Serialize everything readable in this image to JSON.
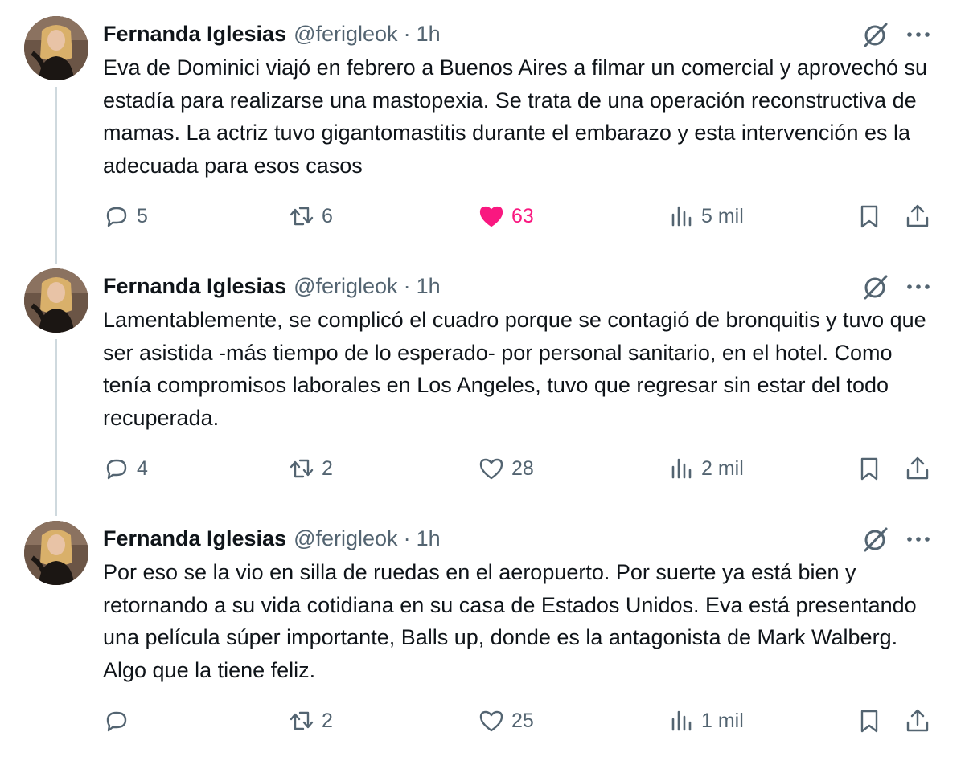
{
  "colors": {
    "text": "#0f1419",
    "secondary": "#536471",
    "like_active": "#f91880",
    "thread_line": "#cfd9de"
  },
  "tweets": [
    {
      "author_name": "Fernanda Iglesias",
      "handle": "@ferigleok",
      "separator": "·",
      "time": "1h",
      "text": "Eva de Dominici viajó en febrero a Buenos Aires a filmar un comercial y aprovechó su estadía para realizarse una mastopexia. Se trata de una operación reconstructiva de mamas. La actriz tuvo gigantomastitis durante el embarazo y esta intervención es la adecuada para esos casos",
      "replies": "5",
      "reposts": "6",
      "likes": "63",
      "liked": true,
      "views": "5 mil"
    },
    {
      "author_name": "Fernanda Iglesias",
      "handle": "@ferigleok",
      "separator": "·",
      "time": "1h",
      "text": "Lamentablemente, se complicó el cuadro porque se contagió de bronquitis y tuvo que ser asistida -más tiempo de lo esperado- por personal sanitario, en el hotel. Como tenía compromisos laborales en Los Angeles, tuvo que regresar sin estar del todo recuperada.",
      "replies": "4",
      "reposts": "2",
      "likes": "28",
      "liked": false,
      "views": "2 mil"
    },
    {
      "author_name": "Fernanda Iglesias",
      "handle": "@ferigleok",
      "separator": "·",
      "time": "1h",
      "text": "Por eso se la vio en silla de ruedas en el aeropuerto. Por suerte ya está bien y retornando a su vida cotidiana en su casa de Estados Unidos. Eva está presentando una película súper importante, Balls up, donde es la antagonista de Mark Walberg. Algo que la tiene feliz.",
      "replies": "",
      "reposts": "2",
      "likes": "25",
      "liked": false,
      "views": "1 mil"
    }
  ],
  "icons": {
    "grok": "grok-icon",
    "more": "more-icon",
    "reply": "reply-icon",
    "repost": "repost-icon",
    "like": "heart-icon",
    "views": "views-icon",
    "bookmark": "bookmark-icon",
    "share": "share-icon"
  }
}
